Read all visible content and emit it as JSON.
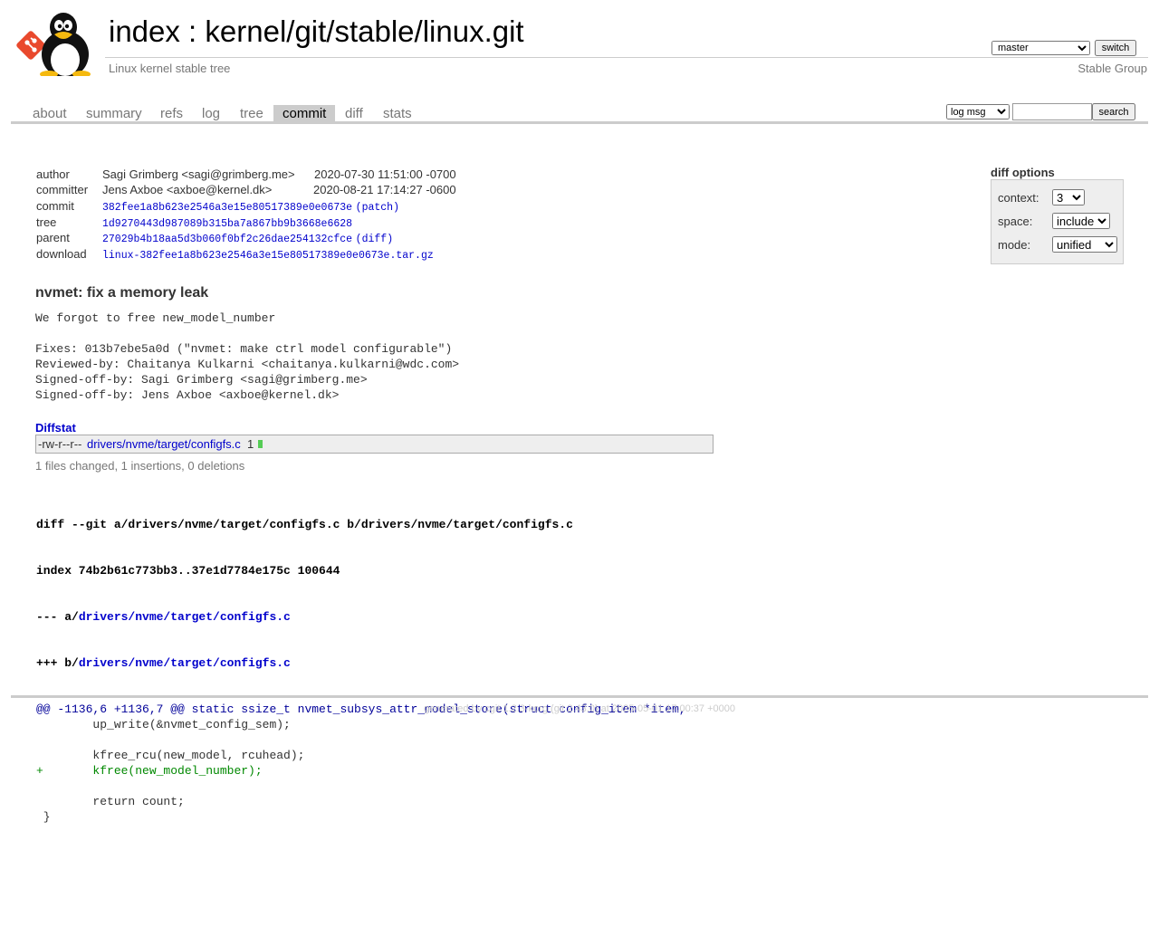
{
  "header": {
    "title_index": "index",
    "title_sep": " : ",
    "title_repo": "kernel/git/stable/linux.git",
    "description": "Linux kernel stable tree",
    "owner": "Stable Group",
    "branch_value": "master",
    "switch_label": "switch"
  },
  "tabs": [
    {
      "label": "about"
    },
    {
      "label": "summary"
    },
    {
      "label": "refs"
    },
    {
      "label": "log"
    },
    {
      "label": "tree"
    },
    {
      "label": "commit",
      "active": true
    },
    {
      "label": "diff"
    },
    {
      "label": "stats"
    }
  ],
  "search": {
    "mode_value": "log msg",
    "query": "",
    "button_label": "search"
  },
  "commit_info": {
    "author_label": "author",
    "author": "Sagi Grimberg <sagi@grimberg.me>",
    "author_date": "2020-07-30 11:51:00 -0700",
    "committer_label": "committer",
    "committer": "Jens Axboe <axboe@kernel.dk>",
    "committer_date": "2020-08-21 17:14:27 -0600",
    "commit_label": "commit",
    "commit_hash": "382fee1a8b623e2546a3e15e80517389e0e0673e",
    "commit_extra": "patch",
    "tree_label": "tree",
    "tree_hash": "1d9270443d987089b315ba7a867bb9b3668e6628",
    "parent_label": "parent",
    "parent_hash": "27029b4b18aa5d3b060f0bf2c26dae254132cfce",
    "parent_extra": "diff",
    "download_label": "download",
    "download_file": "linux-382fee1a8b623e2546a3e15e80517389e0e0673e.tar.gz"
  },
  "diff_options": {
    "title": "diff options",
    "context_label": "context:",
    "context_value": "3",
    "space_label": "space:",
    "space_value": "include",
    "mode_label": "mode:",
    "mode_value": "unified"
  },
  "message": {
    "subject": "nvmet: fix a memory leak",
    "body": "We forgot to free new_model_number\n\nFixes: 013b7ebe5a0d (\"nvmet: make ctrl model configurable\")\nReviewed-by: Chaitanya Kulkarni <chaitanya.kulkarni@wdc.com>\nSigned-off-by: Sagi Grimberg <sagi@grimberg.me>\nSigned-off-by: Jens Axboe <axboe@kernel.dk>"
  },
  "diffstat": {
    "header": "Diffstat",
    "mode": "-rw-r--r--",
    "file": "drivers/nvme/target/configfs.c",
    "count": "1",
    "summary": "1 files changed, 1 insertions, 0 deletions",
    "bar_color": "#55cc55"
  },
  "diff": {
    "git_line": "diff --git a/drivers/nvme/target/configfs.c b/drivers/nvme/target/configfs.c",
    "index_line": "index 74b2b61c773bb3..37e1d7784e175c 100644",
    "minus_prefix": "--- a/",
    "plus_prefix": "+++ b/",
    "path": "drivers/nvme/target/configfs.c",
    "lines": [
      {
        "type": "hunk",
        "text": "@@ -1136,6 +1136,7 @@ static ssize_t nvmet_subsys_attr_model_store(struct config_item *item,"
      },
      {
        "type": "ctx",
        "text": " \tup_write(&nvmet_config_sem);"
      },
      {
        "type": "ctx",
        "text": " "
      },
      {
        "type": "ctx",
        "text": " \tkfree_rcu(new_model, rcuhead);"
      },
      {
        "type": "add",
        "text": "+\tkfree(new_model_number);"
      },
      {
        "type": "ctx",
        "text": " "
      },
      {
        "type": "ctx",
        "text": " \treturn count;"
      },
      {
        "type": "ctx",
        "text": " }"
      }
    ]
  },
  "footer": {
    "prefix": "generated by ",
    "link": "cgit 1.2.3-korg",
    "suffix": " (git 2.43.0) at 2025-05-01 17:00:37 +0000"
  },
  "colors": {
    "link": "#0000cc",
    "add": "#008800",
    "hunk": "#000099",
    "rule": "#cccccc"
  },
  "logo_icon": "git-tux-logo-icon"
}
